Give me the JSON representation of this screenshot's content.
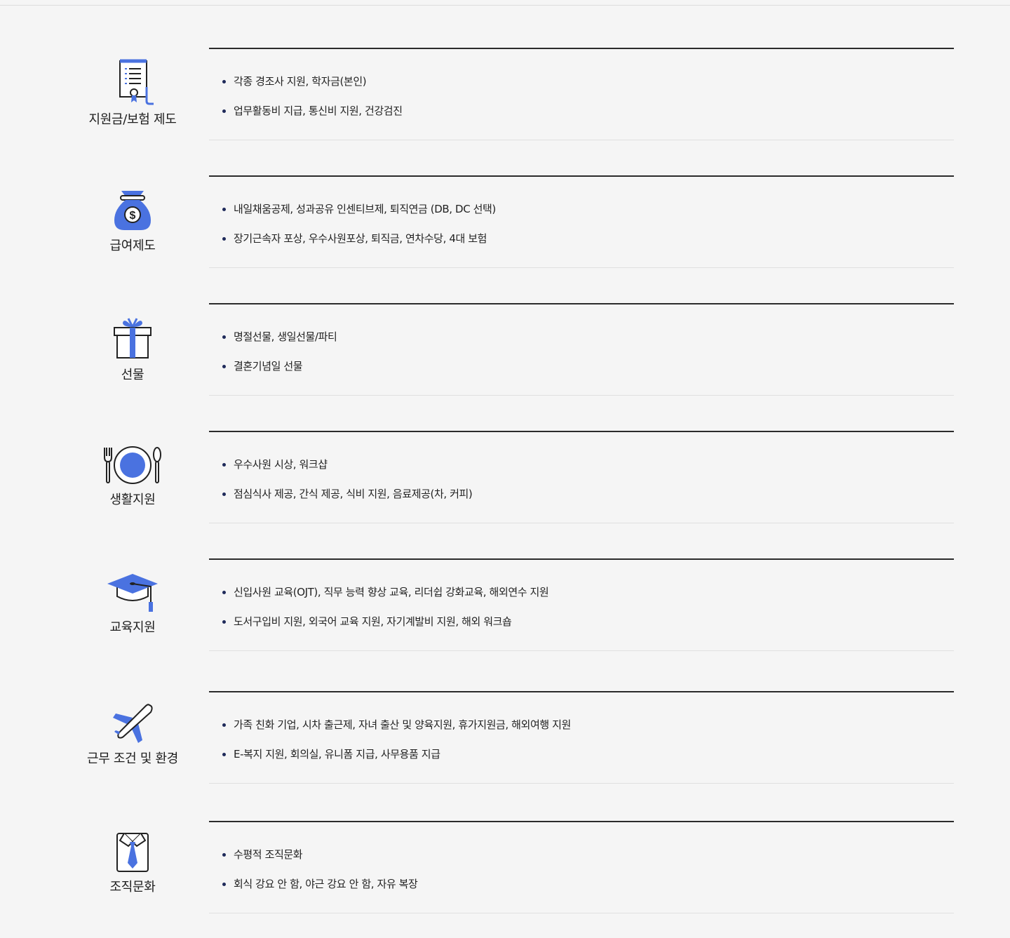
{
  "sections": [
    {
      "icon": "certificate-document-icon",
      "title": "지원금/보험 제도",
      "items": [
        "각종 경조사 지원, 학자금(본인)",
        "업무활동비 지급, 통신비 지원, 건강검진"
      ]
    },
    {
      "icon": "money-bag-icon",
      "title": "급여제도",
      "items": [
        "내일채움공제, 성과공유 인센티브제, 퇴직연금 (DB, DC 선택)",
        "장기근속자 포상, 우수사원포상, 퇴직금, 연차수당, 4대 보험"
      ]
    },
    {
      "icon": "gift-box-icon",
      "title": "선물",
      "items": [
        "명절선물, 생일선물/파티",
        "결혼기념일 선물"
      ]
    },
    {
      "icon": "plate-fork-spoon-icon",
      "title": "생활지원",
      "items": [
        "우수사원 시상, 워크샵",
        "점심식사 제공, 간식 제공, 식비 지원, 음료제공(차, 커피)"
      ]
    },
    {
      "icon": "graduation-cap-icon",
      "title": "교육지원",
      "items": [
        "신입사원 교육(OJT), 직무 능력 향상 교육, 리더쉽 강화교육, 해외연수 지원",
        "도서구입비 지원, 외국어 교육 지원, 자기계발비 지원, 해외 워크숍"
      ]
    },
    {
      "icon": "airplane-icon",
      "title": "근무 조건 및 환경",
      "items": [
        "가족 친화 기업, 시차 출근제, 자녀 출산 및 양육지원, 휴가지원금, 해외여행 지원",
        "E-복지 지원, 회의실, 유니폼 지급, 사무용품 지급"
      ]
    },
    {
      "icon": "shirt-tie-icon",
      "title": "조직문화",
      "items": [
        "수평적 조직문화",
        "회식 강요 안 함, 야근 강요 안 함, 자유 복장"
      ]
    }
  ],
  "colors": {
    "accent": "#4a72e0",
    "icon_stroke": "#222222",
    "background": "#f5f5f5",
    "bullet": "#1f2a5a"
  }
}
